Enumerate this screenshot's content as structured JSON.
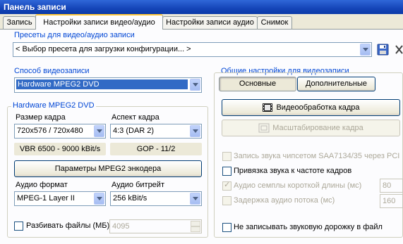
{
  "window": {
    "title": "Панель записи"
  },
  "tabs": [
    {
      "label": "Запись"
    },
    {
      "label": "Настройки записи видео/аудио"
    },
    {
      "label": "Настройки записи аудио"
    },
    {
      "label": "Снимок"
    }
  ],
  "presets": {
    "title": "Пресеты для видео/аудио записи",
    "value": "< Выбор пресета для загрузки конфигурации... >"
  },
  "video_method": {
    "title": "Способ видеозаписи",
    "value": "Hardware MPEG2 DVD"
  },
  "hw": {
    "title": "Hardware MPEG2 DVD",
    "frame_size_label": "Размер кадра",
    "frame_size_value": "720x576 / 720x480",
    "aspect_label": "Аспект кадра",
    "aspect_value": "4:3 (DAR 2)",
    "vbr_info": "VBR 6500 - 9000 kBit/s",
    "gop_info": "GOP - 11/2",
    "encoder_button": "Параметры MPEG2 энкодера",
    "audio_format_label": "Аудио формат",
    "audio_format_value": "MPEG-1 Layer II",
    "audio_bitrate_label": "Аудио битрейт",
    "audio_bitrate_value": "256 kBit/s",
    "split_label": "Разбивать файлы (МБ)",
    "split_value": "4095"
  },
  "general": {
    "title": "Общие настройки для видеозаписи",
    "tab_basic": "Основные",
    "tab_advanced": "Дополнительные",
    "frame_processing_button": "Видеообработка кадра",
    "scaling_button": "Масштабирование кадра",
    "chk_saa": "Запись звука чипсетом SAA7134/35 через PCI",
    "chk_bind": "Привязка звука к частоте кадров",
    "chk_short": "Аудио семплы короткой длины (мс)",
    "short_value": "80",
    "chk_delay": "Задержка аудио потока (мс)",
    "delay_value": "160",
    "chk_no_audio": "Не записывать звуковую дорожку в файл"
  },
  "colors": {
    "title_bar": "#1545b8",
    "group_title": "#0046d5",
    "selection": "#316ac5",
    "active_tab_accent": "#ffc83c"
  }
}
